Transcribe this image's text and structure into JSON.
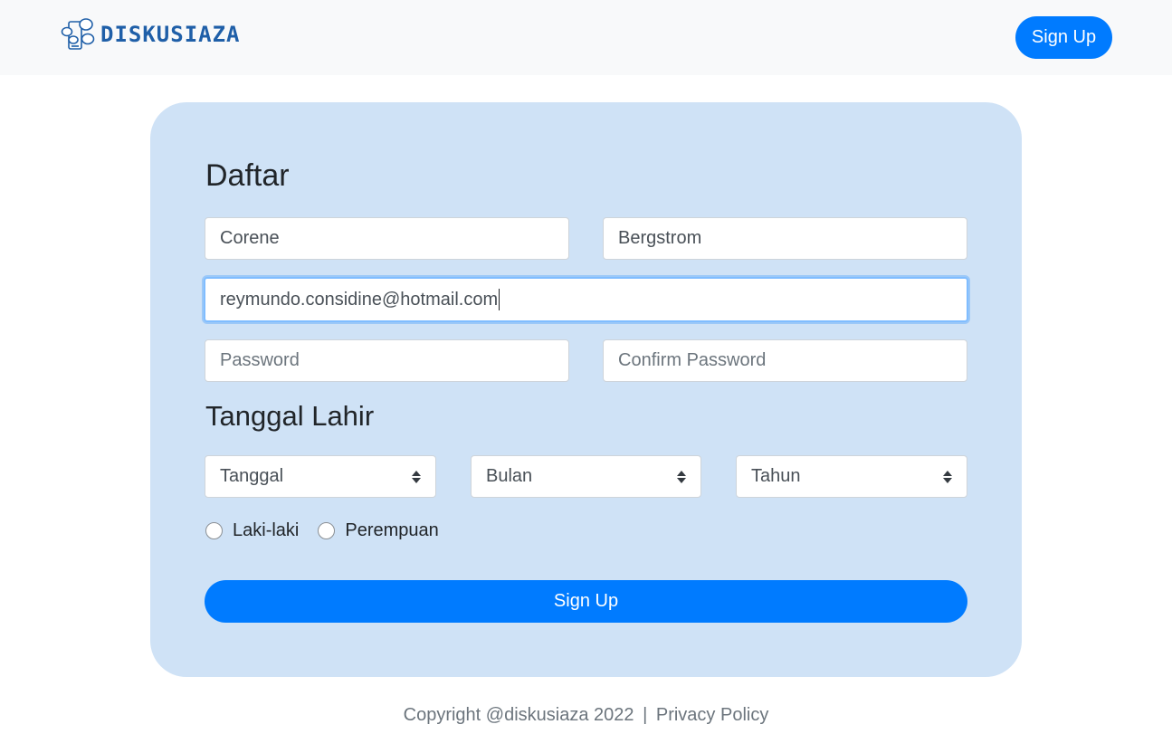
{
  "navbar": {
    "brand_name": "DISKUSIAZA",
    "brand_icon": "chat-bubbles-logo-icon",
    "signup_label": "Sign Up"
  },
  "form": {
    "title": "Daftar",
    "first_name": "Corene",
    "last_name": "Bergstrom",
    "email": "reymundo.considine@hotmail.com",
    "password_placeholder": "Password",
    "confirm_password_placeholder": "Confirm Password",
    "birthdate_title": "Tanggal Lahir",
    "day_select": "Tanggal",
    "month_select": "Bulan",
    "year_select": "Tahun",
    "gender_male": "Laki-laki",
    "gender_female": "Perempuan",
    "submit_label": "Sign Up"
  },
  "footer": {
    "copyright": "Copyright @diskusiaza 2022",
    "separator": "|",
    "privacy": "Privacy Policy"
  },
  "colors": {
    "primary": "#007bff",
    "card_bg": "#cfe2f6",
    "navbar_bg": "#f8f9fa",
    "brand": "#1f5fa8"
  }
}
